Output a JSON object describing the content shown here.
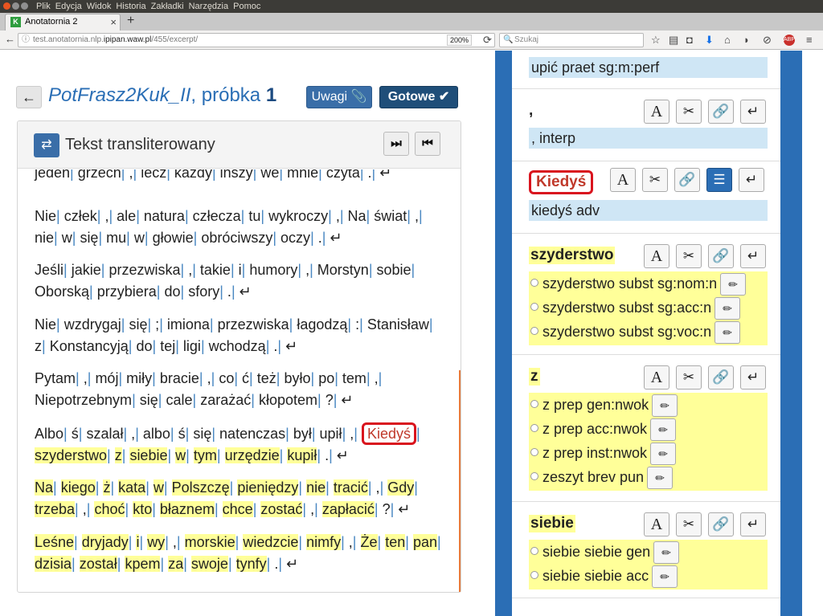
{
  "browser": {
    "menu": [
      "Plik",
      "Edycja",
      "Widok",
      "Historia",
      "Zakładki",
      "Narzędzia",
      "Pomoc"
    ],
    "tab_title": "Anotatornia 2",
    "tab_favicon": "K",
    "url_prefix": "test.anotatornia.nlp.",
    "url_domain": "ipipan.waw.pl",
    "url_path": "/455/excerpt/",
    "zoom": "200%",
    "search_placeholder": "Szukaj"
  },
  "header": {
    "back_icon": "←",
    "title_part1": "PotFrasz2Kuk_II",
    "title_part2": ", próbka ",
    "title_number": "1",
    "uwagi_label": "Uwagi",
    "gotowe_label": "Gotowe"
  },
  "left_panel": {
    "title": "Tekst transliterowany",
    "nav_next_icon": "⏭",
    "nav_prev_icon": "⏮",
    "paragraphs": [
      {
        "tokens": [
          {
            "t": "jeden"
          },
          {
            "t": "grzech"
          },
          {
            "t": ","
          },
          {
            "t": "lecz"
          },
          {
            "t": "każdy"
          },
          {
            "t": "inszy"
          },
          {
            "t": "we"
          },
          {
            "t": "mnie"
          },
          {
            "t": "czyta"
          },
          {
            "t": "."
          }
        ],
        "end": "↵",
        "partial_top": true
      },
      {
        "tokens": [
          {
            "t": "Nie"
          },
          {
            "t": "człek"
          },
          {
            "t": ","
          },
          {
            "t": "ale"
          },
          {
            "t": "natura"
          },
          {
            "t": "człecza"
          },
          {
            "t": "tu"
          },
          {
            "t": "wykroczy"
          },
          {
            "t": ","
          },
          {
            "t": "Na"
          },
          {
            "t": "świat"
          },
          {
            "t": ","
          },
          {
            "t": "nie"
          },
          {
            "t": "w"
          },
          {
            "t": "się"
          },
          {
            "t": "mu"
          },
          {
            "t": "w"
          },
          {
            "t": "głowie"
          },
          {
            "t": "obróciwszy"
          },
          {
            "t": "oczy"
          },
          {
            "t": "."
          }
        ],
        "end": "↵"
      },
      {
        "tokens": [
          {
            "t": "Jeśli"
          },
          {
            "t": "jakie"
          },
          {
            "t": "przezwiska"
          },
          {
            "t": ","
          },
          {
            "t": "takie"
          },
          {
            "t": "i"
          },
          {
            "t": "humory"
          },
          {
            "t": ","
          },
          {
            "t": "Morstyn"
          },
          {
            "t": "sobie"
          },
          {
            "t": "Oborską"
          },
          {
            "t": "przybiera"
          },
          {
            "t": "do"
          },
          {
            "t": "sfory"
          },
          {
            "t": "."
          }
        ],
        "end": "↵"
      },
      {
        "tokens": [
          {
            "t": "Nie"
          },
          {
            "t": "wzdrygaj"
          },
          {
            "t": "się"
          },
          {
            "t": ";"
          },
          {
            "t": "imiona"
          },
          {
            "t": "przezwiska"
          },
          {
            "t": "łagodzą"
          },
          {
            "t": ":"
          },
          {
            "t": "Stanisław"
          },
          {
            "t": "z"
          },
          {
            "t": "Konstancyją"
          },
          {
            "t": "do"
          },
          {
            "t": "tej"
          },
          {
            "t": "ligi"
          },
          {
            "t": "wchodzą"
          },
          {
            "t": "."
          }
        ],
        "end": "↵"
      },
      {
        "tokens": [
          {
            "t": "Pytam"
          },
          {
            "t": ","
          },
          {
            "t": "mój"
          },
          {
            "t": "miły"
          },
          {
            "t": "bracie"
          },
          {
            "t": ","
          },
          {
            "t": "co"
          },
          {
            "t": "ć"
          },
          {
            "t": "też"
          },
          {
            "t": "było"
          },
          {
            "t": "po"
          },
          {
            "t": "tem"
          },
          {
            "t": ","
          },
          {
            "t": "Niepotrzebnym"
          },
          {
            "t": "się"
          },
          {
            "t": "cale"
          },
          {
            "t": "zarażać"
          },
          {
            "t": "kłopotem"
          },
          {
            "t": "?"
          }
        ],
        "end": "↵"
      },
      {
        "tokens": [
          {
            "t": "Albo"
          },
          {
            "t": "ś"
          },
          {
            "t": "szalał"
          },
          {
            "t": ","
          },
          {
            "t": "albo"
          },
          {
            "t": "ś"
          },
          {
            "t": "się"
          },
          {
            "t": "natenczas"
          },
          {
            "t": "był"
          },
          {
            "t": "upił"
          },
          {
            "t": ","
          },
          {
            "t": "Kiedyś",
            "sel": true
          },
          {
            "t": "szyderstwo",
            "hl": true
          },
          {
            "t": "z",
            "hl": true
          },
          {
            "t": "siebie",
            "hl": true
          },
          {
            "t": "w",
            "hl": true
          },
          {
            "t": "tym",
            "hl": true
          },
          {
            "t": "urzędzie",
            "hl": true
          },
          {
            "t": "kupił",
            "hl": true
          },
          {
            "t": "."
          }
        ],
        "end": "↵"
      },
      {
        "tokens": [
          {
            "t": "Na",
            "hl": true
          },
          {
            "t": "kiego",
            "hl": true
          },
          {
            "t": "ż",
            "hl": true
          },
          {
            "t": "kata",
            "hl": true
          },
          {
            "t": "w",
            "hl": true
          },
          {
            "t": "Polszczę",
            "hl": true
          },
          {
            "t": "pieniędzy",
            "hl": true
          },
          {
            "t": "nie",
            "hl": true
          },
          {
            "t": "tracić",
            "hl": true
          },
          {
            "t": ","
          },
          {
            "t": "Gdy",
            "hl": true
          },
          {
            "t": "trzeba",
            "hl": true
          },
          {
            "t": ","
          },
          {
            "t": "choć",
            "hl": true
          },
          {
            "t": "kto",
            "hl": true
          },
          {
            "t": "błaznem",
            "hl": true
          },
          {
            "t": "chce",
            "hl": true
          },
          {
            "t": "zostać",
            "hl": true
          },
          {
            "t": ","
          },
          {
            "t": "zapłacić",
            "hl": true
          },
          {
            "t": "?"
          }
        ],
        "end": "↵"
      },
      {
        "tokens": [
          {
            "t": "Leśne",
            "hl": true
          },
          {
            "t": "dryjady",
            "hl": true
          },
          {
            "t": "i",
            "hl": true
          },
          {
            "t": "wy",
            "hl": true
          },
          {
            "t": ","
          },
          {
            "t": "morskie",
            "hl": true
          },
          {
            "t": "wiedzcie",
            "hl": true
          },
          {
            "t": "nimfy",
            "hl": true
          },
          {
            "t": ","
          },
          {
            "t": "Że",
            "hl": true
          },
          {
            "t": "ten",
            "hl": true
          },
          {
            "t": "pan",
            "hl": true
          },
          {
            "t": "dzisia",
            "hl": true
          },
          {
            "t": "został",
            "hl": true
          },
          {
            "t": "kpem",
            "hl": true
          },
          {
            "t": "za",
            "hl": true
          },
          {
            "t": "swoje",
            "hl": true
          },
          {
            "t": "tynfy",
            "hl": true
          },
          {
            "t": "."
          }
        ],
        "end": "↵"
      }
    ]
  },
  "right_panel": {
    "sections": [
      {
        "id": "upil",
        "word": "",
        "tag": "upić praet sg:m:perf",
        "buttons": []
      },
      {
        "id": "comma",
        "word": ",",
        "tag": ", interp",
        "buttons": [
          "A",
          "✂",
          "🔗",
          "↵"
        ]
      },
      {
        "id": "kiedys",
        "word": "Kiedyś",
        "tag": "kiedyś adv",
        "selected": true,
        "buttons": [
          "A",
          "✂",
          "🔗",
          "☰",
          "↵"
        ]
      },
      {
        "id": "szyderstwo",
        "word": "szyderstwo",
        "options": [
          "szyderstwo subst sg:nom:n",
          "szyderstwo subst sg:acc:n",
          "szyderstwo subst sg:voc:n"
        ],
        "buttons": [
          "A",
          "✂",
          "🔗",
          "↵"
        ]
      },
      {
        "id": "z",
        "word": "z",
        "options": [
          "z prep gen:nwok",
          "z prep acc:nwok",
          "z prep inst:nwok",
          "zeszyt brev pun"
        ],
        "buttons": [
          "A",
          "✂",
          "🔗",
          "↵"
        ]
      },
      {
        "id": "siebie",
        "word": "siebie",
        "options": [
          "siebie siebie gen",
          "siebie siebie acc"
        ],
        "buttons": [
          "A",
          "✂",
          "🔗",
          "↵"
        ]
      }
    ],
    "pencil_icon": "✏"
  }
}
